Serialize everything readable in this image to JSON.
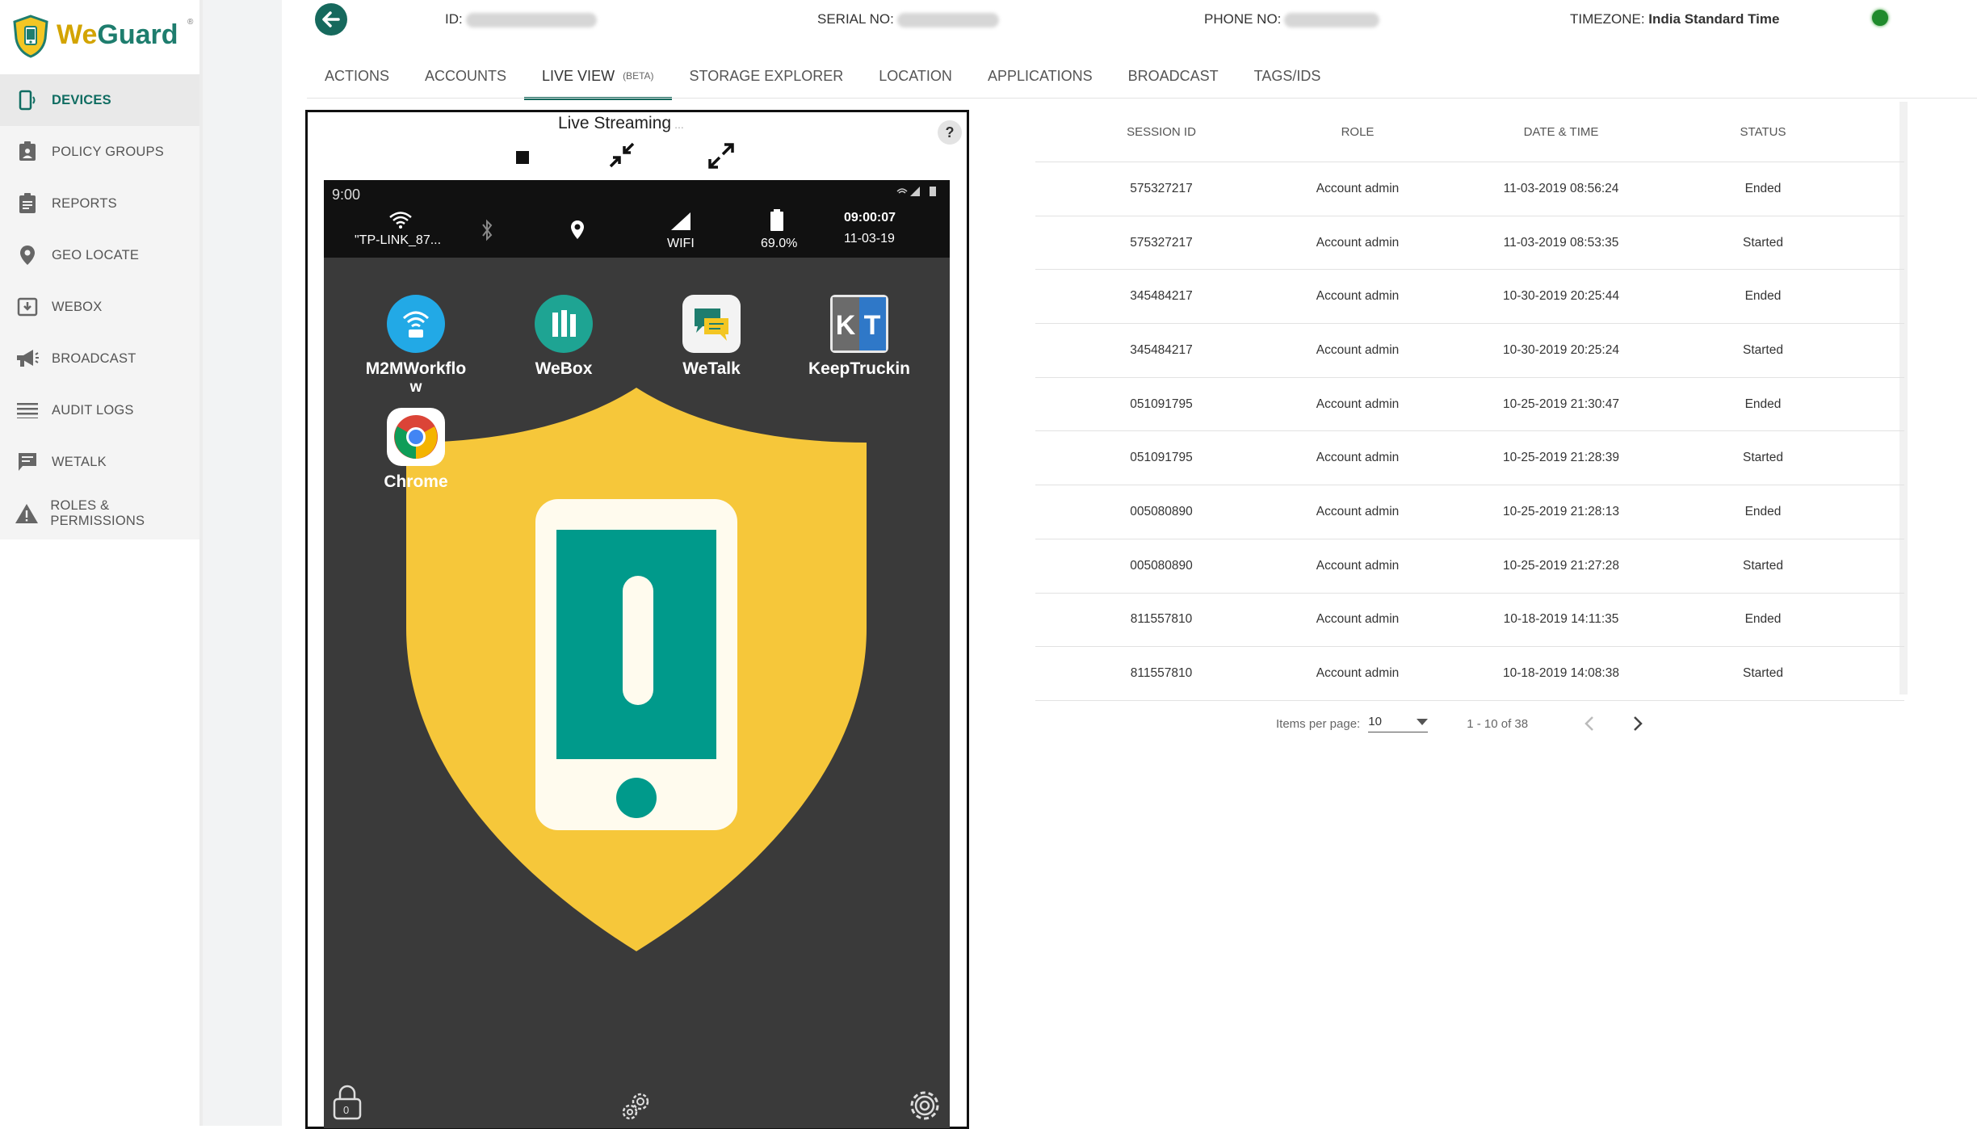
{
  "brand": {
    "name_part1": "We",
    "name_part2": "Guard",
    "reg": "®"
  },
  "sidebar": {
    "items": [
      {
        "label": "DEVICES",
        "icon": "device-icon",
        "active": true
      },
      {
        "label": "POLICY GROUPS",
        "icon": "policy-badge-icon"
      },
      {
        "label": "REPORTS",
        "icon": "clipboard-icon"
      },
      {
        "label": "GEO LOCATE",
        "icon": "location-pin-icon"
      },
      {
        "label": "WEBOX",
        "icon": "webox-icon"
      },
      {
        "label": "BROADCAST",
        "icon": "megaphone-icon"
      },
      {
        "label": "AUDIT LOGS",
        "icon": "list-icon"
      },
      {
        "label": "WETALK",
        "icon": "chat-icon"
      },
      {
        "label": "ROLES & PERMISSIONS",
        "icon": "warning-icon"
      }
    ]
  },
  "header": {
    "id_label": "ID:",
    "serial_label": "SERIAL NO:",
    "phone_label": "PHONE NO:",
    "timezone_label": "TIMEZONE:",
    "timezone_value": "India Standard Time",
    "online_color": "#1f8a2c"
  },
  "tabs": [
    {
      "label": "ACTIONS"
    },
    {
      "label": "ACCOUNTS"
    },
    {
      "label": "LIVE VIEW",
      "badge": "(BETA)",
      "active": true
    },
    {
      "label": "STORAGE EXPLORER"
    },
    {
      "label": "LOCATION"
    },
    {
      "label": "APPLICATIONS"
    },
    {
      "label": "BROADCAST"
    },
    {
      "label": "TAGS/IDS"
    }
  ],
  "live_view": {
    "title": "Live Streaming",
    "title_dots": "...",
    "help": "?",
    "device": {
      "time": "9:00",
      "wifi_name": "\"TP-LINK_87...",
      "network_label": "WIFI",
      "battery": "69.0%",
      "clock": "09:00:07",
      "date": "11-03-19",
      "apps": [
        {
          "name": "M2MWorkflow",
          "line1": "M2MWorkflo",
          "line2": "w"
        },
        {
          "name": "WeBox",
          "line1": "WeBox"
        },
        {
          "name": "WeTalk",
          "line1": "WeTalk"
        },
        {
          "name": "KeepTruckin",
          "line1": "KeepTruckin"
        },
        {
          "name": "Chrome",
          "line1": "Chrome"
        }
      ],
      "lock_count": "0"
    }
  },
  "sessions": {
    "headers": [
      "SESSION ID",
      "ROLE",
      "DATE & TIME",
      "STATUS"
    ],
    "rows": [
      [
        "575327217",
        "Account admin",
        "11-03-2019 08:56:24",
        "Ended"
      ],
      [
        "575327217",
        "Account admin",
        "11-03-2019 08:53:35",
        "Started"
      ],
      [
        "345484217",
        "Account admin",
        "10-30-2019 20:25:44",
        "Ended"
      ],
      [
        "345484217",
        "Account admin",
        "10-30-2019 20:25:24",
        "Started"
      ],
      [
        "051091795",
        "Account admin",
        "10-25-2019 21:30:47",
        "Ended"
      ],
      [
        "051091795",
        "Account admin",
        "10-25-2019 21:28:39",
        "Started"
      ],
      [
        "005080890",
        "Account admin",
        "10-25-2019 21:28:13",
        "Ended"
      ],
      [
        "005080890",
        "Account admin",
        "10-25-2019 21:27:28",
        "Started"
      ],
      [
        "811557810",
        "Account admin",
        "10-18-2019 14:11:35",
        "Ended"
      ],
      [
        "811557810",
        "Account admin",
        "10-18-2019 14:08:38",
        "Started"
      ]
    ],
    "paginator": {
      "items_per_page_label": "Items per page:",
      "items_per_page": "10",
      "range": "1 - 10 of 38"
    }
  }
}
